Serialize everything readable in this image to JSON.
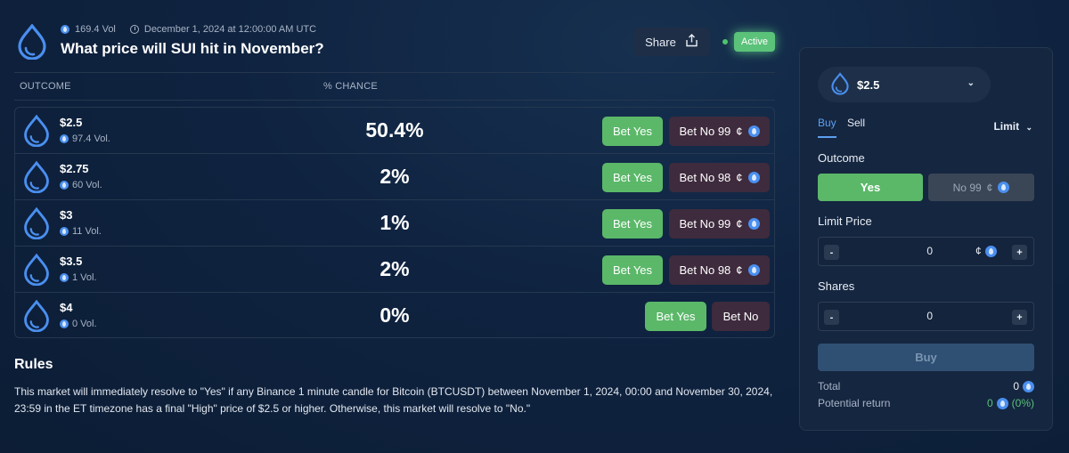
{
  "header": {
    "volume": "169.4 Vol",
    "end_date": "December 1, 2024 at 12:00:00 AM UTC",
    "title": "What price will SUI hit in November?",
    "share_label": "Share",
    "status_label": "Active"
  },
  "table": {
    "col_outcome": "OUTCOME",
    "col_chance": "% CHANCE",
    "rows": [
      {
        "label": "$2.5",
        "volume": "97.4 Vol.",
        "chance": "50.4%",
        "yes_label": "Bet Yes",
        "no_label": "Bet No 99",
        "no_unit": "¢"
      },
      {
        "label": "$2.75",
        "volume": "60 Vol.",
        "chance": "2%",
        "yes_label": "Bet Yes",
        "no_label": "Bet No 98",
        "no_unit": "¢"
      },
      {
        "label": "$3",
        "volume": "11 Vol.",
        "chance": "1%",
        "yes_label": "Bet Yes",
        "no_label": "Bet No 99",
        "no_unit": "¢"
      },
      {
        "label": "$3.5",
        "volume": "1 Vol.",
        "chance": "2%",
        "yes_label": "Bet Yes",
        "no_label": "Bet No 98",
        "no_unit": "¢"
      },
      {
        "label": "$4",
        "volume": "0 Vol.",
        "chance": "0%",
        "yes_label": "Bet Yes",
        "no_label": "Bet No",
        "no_unit": ""
      }
    ]
  },
  "rules": {
    "title": "Rules",
    "text": "This market will immediately resolve to \"Yes\" if any Binance 1 minute candle for Bitcoin (BTCUSDT) between November 1, 2024, 00:00 and November 30, 2024, 23:59 in the ET timezone has a final \"High\" price of $2.5 or higher. Otherwise, this market will resolve to \"No.\""
  },
  "panel": {
    "selected_outcome": "$2.5",
    "tab_buy": "Buy",
    "tab_sell": "Sell",
    "order_type": "Limit",
    "outcome_label": "Outcome",
    "yes_label": "Yes",
    "no_label": "No 99",
    "no_unit": "¢",
    "limit_price_label": "Limit Price",
    "limit_price_value": "0",
    "limit_price_unit": "¢",
    "shares_label": "Shares",
    "shares_value": "0",
    "minus": "-",
    "plus": "+",
    "buy_label": "Buy",
    "total_label": "Total",
    "total_value": "0",
    "return_label": "Potential return",
    "return_value": "0",
    "return_pct": "(0%)"
  },
  "colors": {
    "accent_blue": "#5aa0f0",
    "yes_green": "#5bb869",
    "no_maroon": "#3e2b3d",
    "active_green": "#5bc27a"
  },
  "icons": {
    "market": "sui-drop-icon",
    "coin": "sui-coin-icon"
  }
}
